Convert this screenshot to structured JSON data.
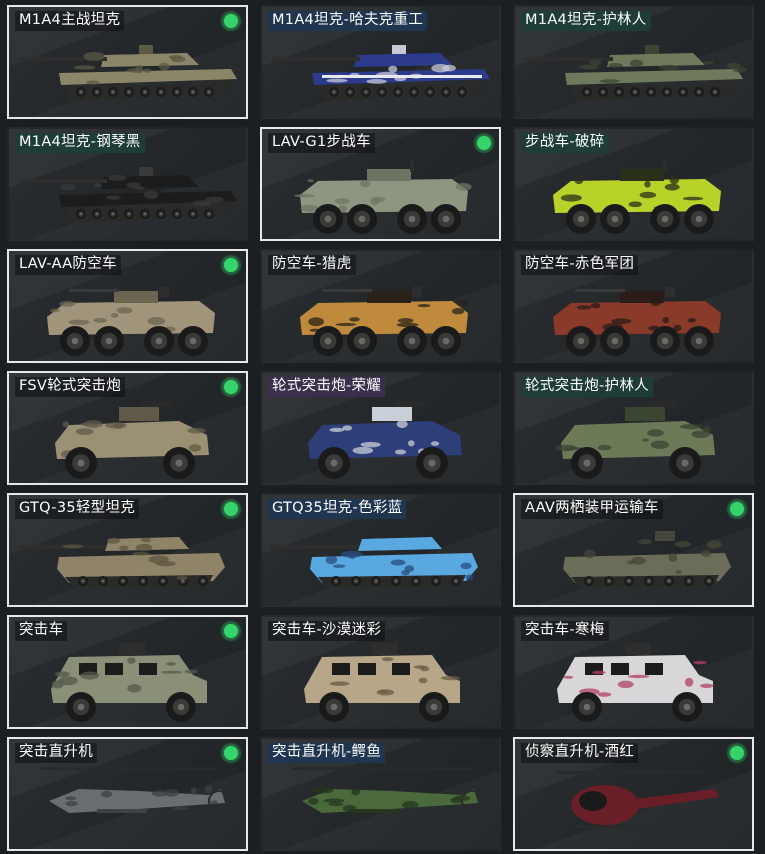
{
  "colors": {
    "active_dot": "#34d46b",
    "selected_border": "#e8e8e8",
    "label_bg_teal": "#1f3d37",
    "label_bg_blue": "#1f3550",
    "label_bg_purple": "#3c2f4e"
  },
  "cards": [
    {
      "name": "M1A4主战坦克",
      "selected": true,
      "equipped": true,
      "label_style": "dark",
      "vehicle": "tank",
      "camo": "desert",
      "hull": "#8c8668",
      "accent": "#5a5a45"
    },
    {
      "name": "M1A4坦克-哈夫克重工",
      "selected": false,
      "equipped": false,
      "label_style": "blue",
      "vehicle": "tank",
      "camo": "navy",
      "hull": "#2c3b8c",
      "accent": "#c8c8d8"
    },
    {
      "name": "M1A4坦克-护林人",
      "selected": false,
      "equipped": false,
      "label_style": "teal",
      "vehicle": "tank",
      "camo": "forest",
      "hull": "#6f7a5c",
      "accent": "#3c4634"
    },
    {
      "name": "M1A4坦克-钢琴黑",
      "selected": false,
      "equipped": false,
      "label_style": "teal",
      "vehicle": "tank",
      "camo": "black",
      "hull": "#1c1c1c",
      "accent": "#3a3a3a"
    },
    {
      "name": "LAV-G1步战车",
      "selected": true,
      "equipped": true,
      "label_style": "dark",
      "vehicle": "ifv",
      "camo": "grey",
      "hull": "#8e9681",
      "accent": "#6d7463"
    },
    {
      "name": "步战车-破碎",
      "selected": false,
      "equipped": false,
      "label_style": "teal",
      "vehicle": "ifv",
      "camo": "lime",
      "hull": "#b8d22a",
      "accent": "#2a2f18"
    },
    {
      "name": "LAV-AA防空车",
      "selected": true,
      "equipped": true,
      "label_style": "dark",
      "vehicle": "aa",
      "camo": "sand",
      "hull": "#a0947a",
      "accent": "#6b6450"
    },
    {
      "name": "防空车-猎虎",
      "selected": false,
      "equipped": false,
      "label_style": "dark",
      "vehicle": "aa",
      "camo": "tiger",
      "hull": "#c08a3c",
      "accent": "#2a2218"
    },
    {
      "name": "防空车-赤色军团",
      "selected": false,
      "equipped": false,
      "label_style": "dark",
      "vehicle": "aa",
      "camo": "red",
      "hull": "#8a3a28",
      "accent": "#2a1c18"
    },
    {
      "name": "FSV轮式突击炮",
      "selected": true,
      "equipped": true,
      "label_style": "dark",
      "vehicle": "fsv",
      "camo": "sand",
      "hull": "#9a9074",
      "accent": "#5f5a48"
    },
    {
      "name": "轮式突击炮-荣耀",
      "selected": false,
      "equipped": false,
      "label_style": "purple",
      "vehicle": "fsv",
      "camo": "navy",
      "hull": "#2d3e78",
      "accent": "#c9cfd8"
    },
    {
      "name": "轮式突击炮-护林人",
      "selected": false,
      "equipped": false,
      "label_style": "teal",
      "vehicle": "fsv",
      "camo": "forest",
      "hull": "#6c7a58",
      "accent": "#3a4532"
    },
    {
      "name": "GTQ-35轻型坦克",
      "selected": true,
      "equipped": true,
      "label_style": "dark",
      "vehicle": "light",
      "camo": "sand",
      "hull": "#8f8468",
      "accent": "#5d5642"
    },
    {
      "name": "GTQ35坦克-色彩蓝",
      "selected": false,
      "equipped": false,
      "label_style": "blue",
      "vehicle": "light",
      "camo": "sky",
      "hull": "#5aa8e0",
      "accent": "#2a4e82"
    },
    {
      "name": "AAV两栖装甲运输车",
      "selected": true,
      "equipped": true,
      "label_style": "dark",
      "vehicle": "aav",
      "camo": "olive",
      "hull": "#6b6d58",
      "accent": "#45473a"
    },
    {
      "name": "突击车",
      "selected": true,
      "equipped": true,
      "label_style": "dark",
      "vehicle": "mrap",
      "camo": "olive",
      "hull": "#8a9078",
      "accent": "#54584a"
    },
    {
      "name": "突击车-沙漠迷彩",
      "selected": false,
      "equipped": false,
      "label_style": "dark",
      "vehicle": "mrap",
      "camo": "desert",
      "hull": "#b8a688",
      "accent": "#6a5a44"
    },
    {
      "name": "突击车-寒梅",
      "selected": false,
      "equipped": false,
      "label_style": "dark",
      "vehicle": "mrap",
      "camo": "white",
      "hull": "#d8d6d8",
      "accent": "#b04060"
    },
    {
      "name": "突击直升机",
      "selected": true,
      "equipped": true,
      "label_style": "dark",
      "vehicle": "heli",
      "camo": "grey",
      "hull": "#6a6e70",
      "accent": "#3e4244"
    },
    {
      "name": "突击直升机-鳄鱼",
      "selected": false,
      "equipped": false,
      "label_style": "blue",
      "vehicle": "heli",
      "camo": "green",
      "hull": "#4a6a3c",
      "accent": "#26361e"
    },
    {
      "name": "侦察直升机-酒红",
      "selected": true,
      "equipped": true,
      "label_style": "dark",
      "vehicle": "scout",
      "camo": "wine",
      "hull": "#6a1e28",
      "accent": "#2a1014"
    }
  ]
}
